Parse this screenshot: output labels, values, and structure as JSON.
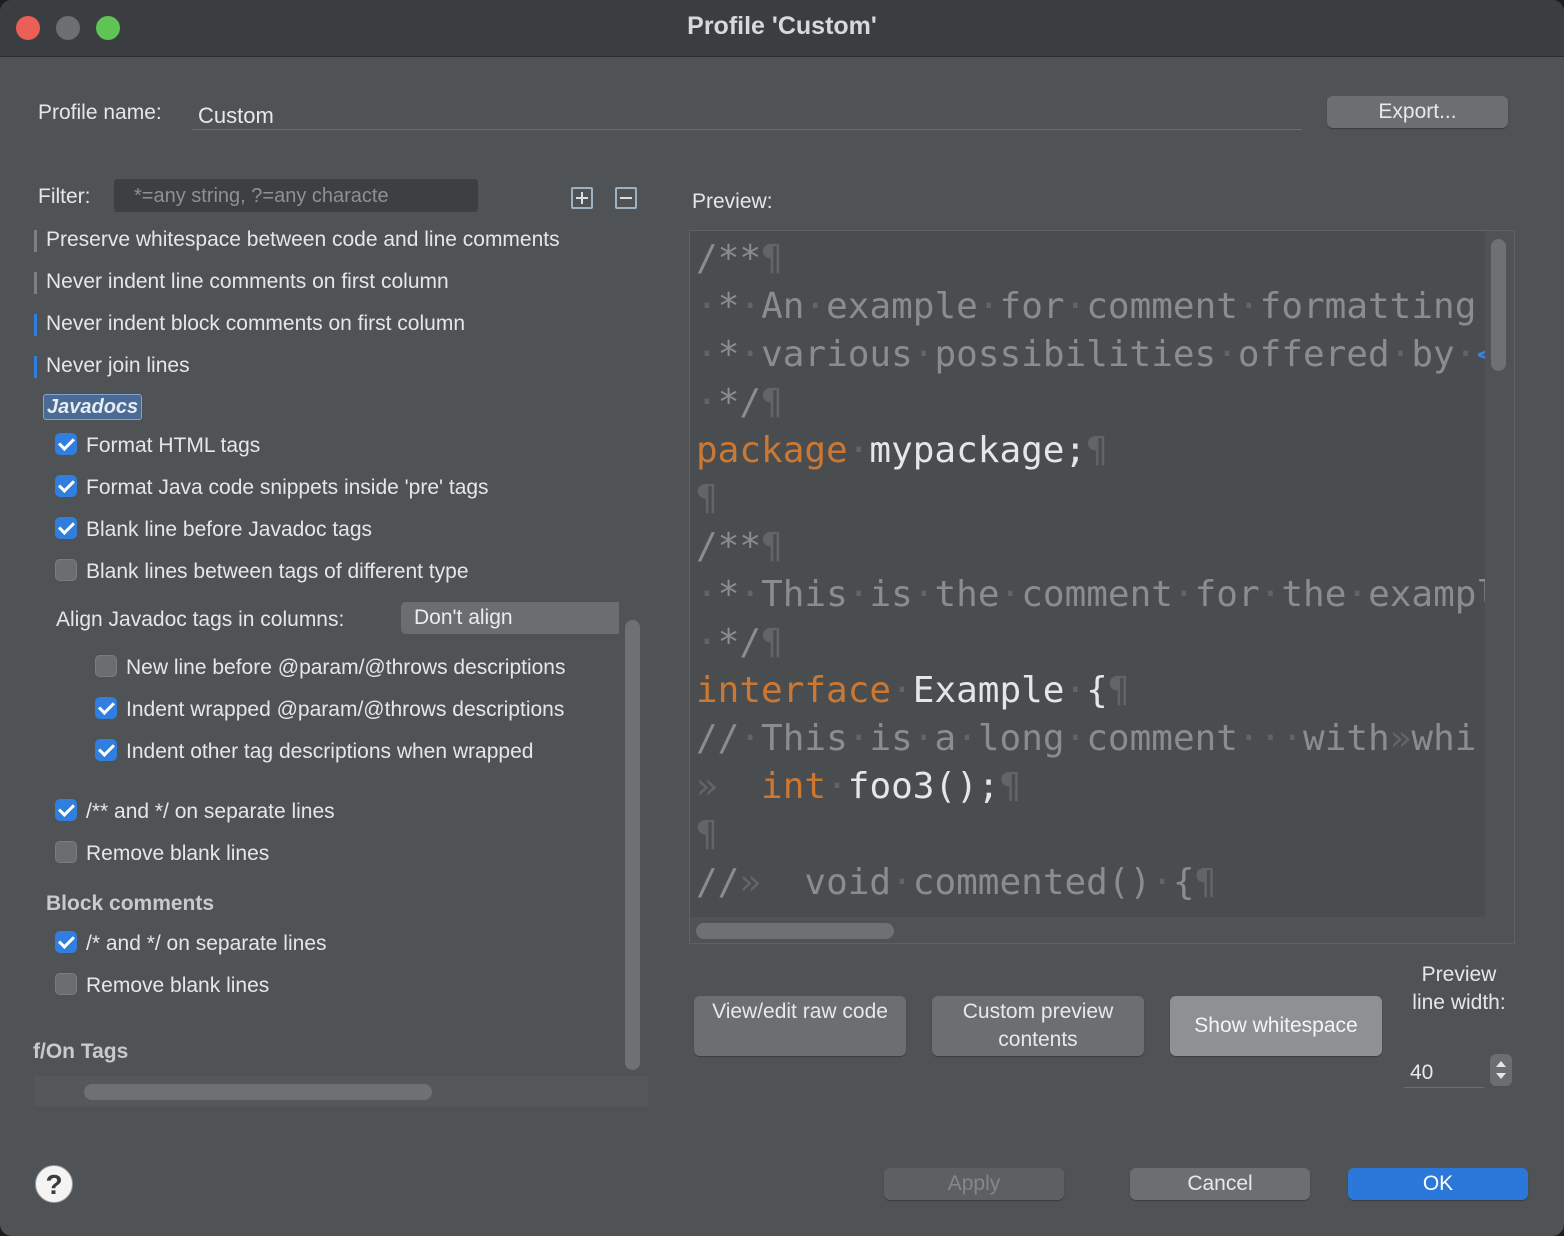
{
  "window": {
    "title": "Profile 'Custom'"
  },
  "profile": {
    "label": "Profile name:",
    "value": "Custom",
    "export_label": "Export..."
  },
  "filter": {
    "label": "Filter:",
    "placeholder": "*=any string, ?=any characte"
  },
  "tree_rows": [
    {
      "label": "Preserve whitespace between code and line comments"
    },
    {
      "label": "Never indent line comments on first column"
    },
    {
      "label": "Never indent block comments on first column"
    },
    {
      "label": "Never join lines"
    }
  ],
  "javadocs": {
    "section": "Javadocs",
    "items": [
      {
        "label": "Format HTML tags",
        "checked": true
      },
      {
        "label": "Format Java code snippets inside 'pre' tags",
        "checked": true
      },
      {
        "label": "Blank line before Javadoc tags",
        "checked": true
      },
      {
        "label": "Blank lines between tags of different type",
        "checked": false
      }
    ],
    "align_label": "Align Javadoc tags in columns:",
    "align_value": "Don't align",
    "sub_items": [
      {
        "label": "New line before @param/@throws descriptions",
        "checked": false
      },
      {
        "label": "Indent wrapped @param/@throws descriptions",
        "checked": true
      },
      {
        "label": "Indent other tag descriptions when wrapped",
        "checked": true
      }
    ],
    "more_items": [
      {
        "label": "/** and */ on separate lines",
        "checked": true
      },
      {
        "label": "Remove blank lines",
        "checked": false
      }
    ]
  },
  "block_comments": {
    "section": "Block comments",
    "items": [
      {
        "label": "/* and */ on separate lines",
        "checked": true
      },
      {
        "label": "Remove blank lines",
        "checked": false
      }
    ]
  },
  "offon_section": "f/On Tags",
  "preview": {
    "label": "Preview:",
    "lines": [
      "/**¶",
      "·*·An·example·for·comment·formatting.",
      "·*·various·possibilities·offered·by·<",
      "·*/¶",
      "package·mypackage;¶",
      "¶",
      "/**¶",
      "·*·This·is·the·comment·for·the·exampl",
      "·*/¶",
      "interface·Example·{¶",
      "//·This·is·a·long·comment···with»whi",
      "»  int·foo3();¶",
      "¶",
      "//»  void·commented()·{¶"
    ]
  },
  "buttons": {
    "view_edit": "View/edit raw code",
    "custom_preview": "Custom preview contents",
    "show_whitespace": "Show whitespace",
    "apply": "Apply",
    "cancel": "Cancel",
    "ok": "OK"
  },
  "line_width": {
    "label": "Preview line width:",
    "value": "40"
  },
  "colors": {
    "accent": "#2f7ee0",
    "keyword": "#cc7832",
    "comment": "#8a8d90"
  },
  "help_glyph": "?"
}
